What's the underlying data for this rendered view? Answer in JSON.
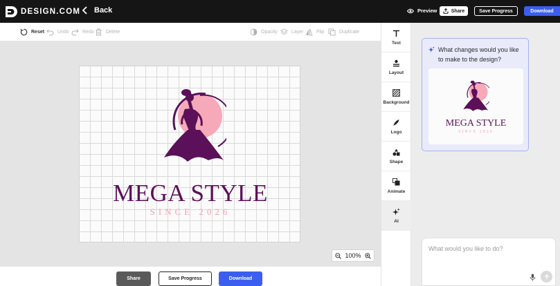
{
  "header": {
    "brand": "DESIGN.COM",
    "back_label": "Back",
    "preview_label": "Preview",
    "share_label": "Share",
    "save_label": "Save Progress",
    "download_label": "Download"
  },
  "toolbar": {
    "reset": "Reset",
    "undo": "Undo",
    "redo": "Redo",
    "delete": "Delete",
    "opacity": "Opacity",
    "layer": "Layer",
    "flip": "Flip",
    "duplicate": "Duplicate"
  },
  "canvas": {
    "logo_title": "MEGA STYLE",
    "logo_subtitle": "SINCE 2026",
    "zoom": "100%"
  },
  "footer": {
    "share_label": "Share",
    "save_label": "Save Progress",
    "download_label": "Download"
  },
  "rail": {
    "items": [
      {
        "label": "Text",
        "icon": "text-icon"
      },
      {
        "label": "Layout",
        "icon": "layout-icon"
      },
      {
        "label": "Background",
        "icon": "background-icon"
      },
      {
        "label": "Logo",
        "icon": "logo-icon"
      },
      {
        "label": "Shape",
        "icon": "shape-icon"
      },
      {
        "label": "Animate",
        "icon": "animate-icon"
      },
      {
        "label": "AI",
        "icon": "ai-sparkle-icon"
      }
    ],
    "active": "AI"
  },
  "chat": {
    "question": "What changes would you like to make to the design?",
    "preview_title": "MEGA STYLE",
    "preview_subtitle": "SINCE 2026",
    "input_placeholder": "What would you like to do?"
  },
  "colors": {
    "topbar": "#151515",
    "accent": "#3b5ef0",
    "brand_purple": "#5b1059",
    "brand_pink": "#f4a0b4",
    "canvas_bg": "#e4e4e4",
    "chat_bg": "#ececec"
  }
}
